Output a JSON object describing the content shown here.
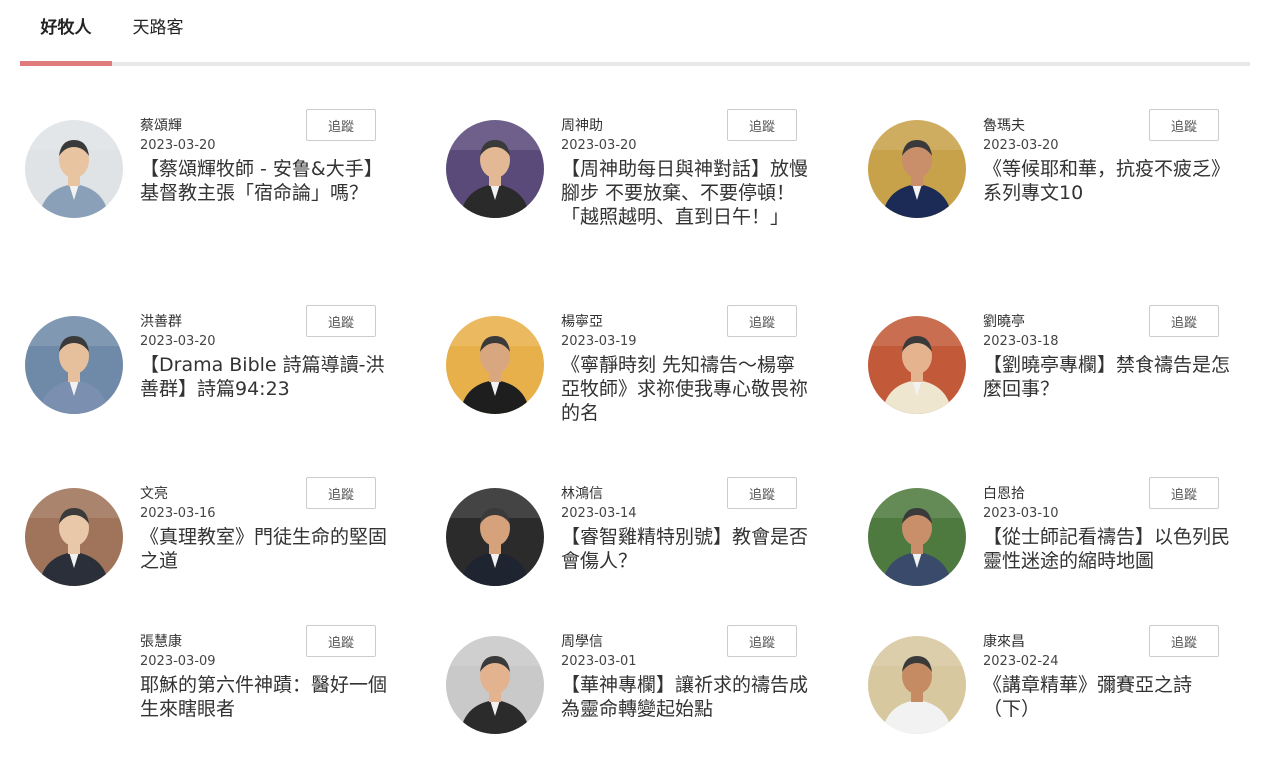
{
  "colors": {
    "accent": "#e07b7b",
    "divider": "#e8e8e8"
  },
  "tabs": [
    {
      "label": "好牧人",
      "active": true
    },
    {
      "label": "天路客",
      "active": false
    }
  ],
  "articles": [
    {
      "author": "蔡頌輝",
      "date": "2023-03-20",
      "title": "【蔡頌輝牧師 - 安鲁&大手】基督教主張「宿命論」嗎？",
      "follow_label": "追蹤",
      "avatar": "photo"
    },
    {
      "author": "周神助",
      "date": "2023-03-20",
      "title": "【周神助每日與神對話】放慢腳步 不要放棄、不要停頓！「越照越明、直到日午！」",
      "follow_label": "追蹤",
      "avatar": "photo"
    },
    {
      "author": "魯瑪夫",
      "date": "2023-03-20",
      "title": "《等候耶和華，抗疫不疲乏》系列專文10",
      "follow_label": "追蹤",
      "avatar": "photo"
    },
    {
      "author": "洪善群",
      "date": "2023-03-20",
      "title": "【Drama Bible 詩篇導讀-洪善群】詩篇94:23",
      "follow_label": "追蹤",
      "avatar": "photo"
    },
    {
      "author": "楊寧亞",
      "date": "2023-03-19",
      "title": "《寧靜時刻 先知禱告～楊寧亞牧師》求祢使我專心敬畏祢的名",
      "follow_label": "追蹤",
      "avatar": "photo"
    },
    {
      "author": "劉曉亭",
      "date": "2023-03-18",
      "title": "【劉曉亭專欄】禁食禱告是怎麼回事？",
      "follow_label": "追蹤",
      "avatar": "photo"
    },
    {
      "author": "文亮",
      "date": "2023-03-16",
      "title": "《真理教室》門徒生命的堅固之道",
      "follow_label": "追蹤",
      "avatar": "photo"
    },
    {
      "author": "林鴻信",
      "date": "2023-03-14",
      "title": "【睿智雞精特別號】教會是否會傷人？",
      "follow_label": "追蹤",
      "avatar": "photo"
    },
    {
      "author": "白恩拾",
      "date": "2023-03-10",
      "title": "【從士師記看禱告】以色列民靈性迷途的縮時地圖",
      "follow_label": "追蹤",
      "avatar": "photo"
    },
    {
      "author": "張慧康",
      "date": "2023-03-09",
      "title": "耶穌的第六件神蹟：醫好一個生來瞎眼者",
      "follow_label": "追蹤",
      "avatar": "none"
    },
    {
      "author": "周學信",
      "date": "2023-03-01",
      "title": "【華神專欄】讓祈求的禱告成為靈命轉變起始點",
      "follow_label": "追蹤",
      "avatar": "photo"
    },
    {
      "author": "康來昌",
      "date": "2023-02-24",
      "title": "《講章精華》彌賽亞之詩（下）",
      "follow_label": "追蹤",
      "avatar": "photo"
    }
  ]
}
